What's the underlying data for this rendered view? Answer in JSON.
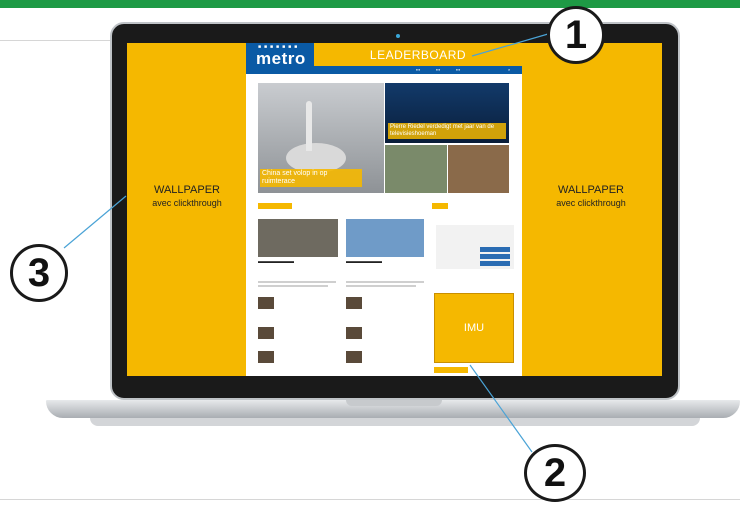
{
  "leaderboard_label": "LEADERBOARD",
  "imu_label": "IMU",
  "wallpaper_left": {
    "title": "WALLPAPER",
    "subtitle": "avec clickthrough"
  },
  "wallpaper_right": {
    "title": "WALLPAPER",
    "subtitle": "avec clickthrough"
  },
  "callouts": [
    "1",
    "2",
    "3"
  ],
  "site": {
    "logo": "metro",
    "hero_title": "China set volop in op ruimterace",
    "hero2_title": "Pierre Riedel verdedigt met jaar van de televisieshoeman"
  },
  "colors": {
    "accent": "#f5b800",
    "brand": "#0a5aa5",
    "top_bar": "#1e9a45",
    "callout_line": "#4aa3d6"
  }
}
